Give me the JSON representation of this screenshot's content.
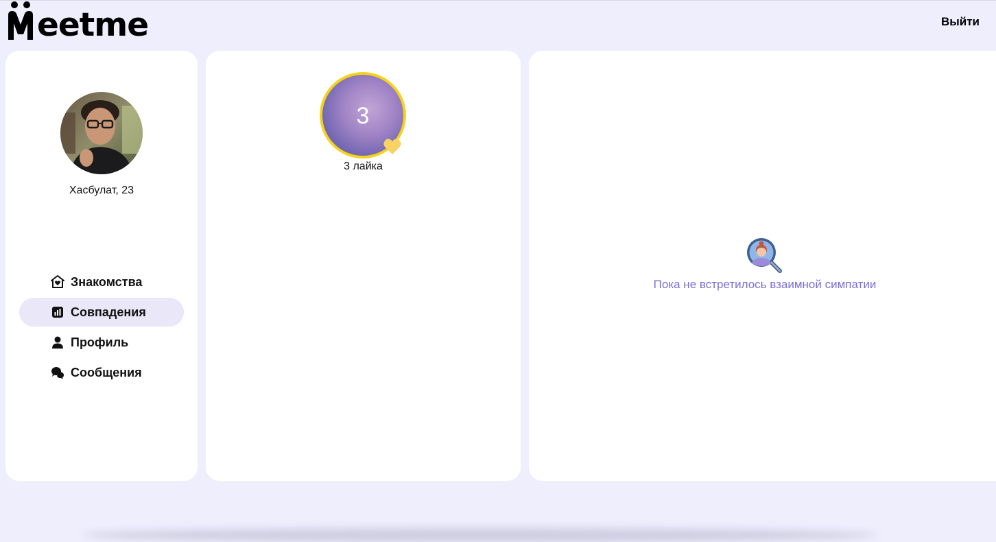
{
  "header": {
    "logo_text": "eetme",
    "logout_label": "Выйти"
  },
  "profile": {
    "name_age": "Хасбулат, 23"
  },
  "nav": {
    "items": [
      {
        "label": "Знакомства",
        "icon": "home-heart-icon"
      },
      {
        "label": "Совпадения",
        "icon": "chart-icon",
        "active": true
      },
      {
        "label": "Профиль",
        "icon": "user-icon"
      },
      {
        "label": "Сообщения",
        "icon": "chat-icon"
      }
    ]
  },
  "likes": {
    "count": "3",
    "label": "3 лайка"
  },
  "matches": {
    "empty_text": "Пока не встретилось взаимной симпатии"
  },
  "colors": {
    "background": "#EFEEFD",
    "panel": "#FFFFFF",
    "active_nav": "#E9E7F8",
    "accent_text": "#7B6FD6",
    "likes_ring": "#F5D21F"
  }
}
